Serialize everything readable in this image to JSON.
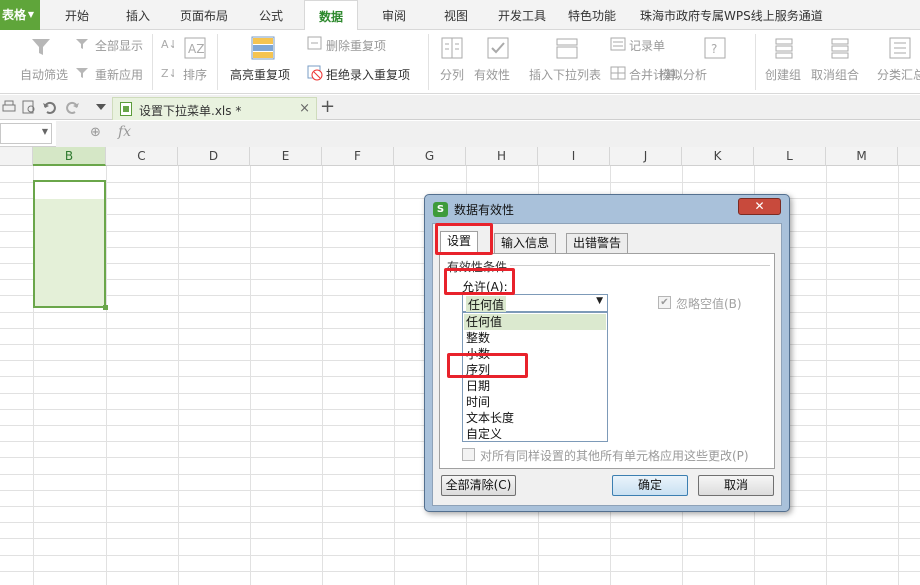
{
  "app": {
    "menu_button_label": "表格"
  },
  "tabs": [
    {
      "label": "开始"
    },
    {
      "label": "插入"
    },
    {
      "label": "页面布局"
    },
    {
      "label": "公式"
    },
    {
      "label": "数据"
    },
    {
      "label": "审阅"
    },
    {
      "label": "视图"
    },
    {
      "label": "开发工具"
    },
    {
      "label": "特色功能"
    },
    {
      "label": "珠海市政府专属WPS线上服务通道"
    }
  ],
  "ribbon": {
    "auto_filter": "自动筛选",
    "show_all": "全部显示",
    "reapply": "重新应用",
    "sort": "排序",
    "highlight_duplicates": "高亮重复项",
    "remove_duplicates": "删除重复项",
    "reject_duplicates": "拒绝录入重复项",
    "split_column": "分列",
    "validation": "有效性",
    "insert_dropdown": "插入下拉列表",
    "record_form": "记录单",
    "consolidate": "合并计算",
    "what_if": "模拟分析",
    "group": "创建组",
    "ungroup": "取消组合",
    "subtotal": "分类汇总"
  },
  "document": {
    "tab_name": "设置下拉菜单.xls *",
    "close_symbol": "×",
    "new_tab_symbol": "+"
  },
  "formula_bar": {
    "fx_label": "fx",
    "zoom_symbol": "⊕"
  },
  "sheet": {
    "columns": [
      "B",
      "C",
      "D",
      "E",
      "F",
      "G",
      "H",
      "I",
      "J",
      "K",
      "L",
      "M"
    ],
    "selected_column": "B"
  },
  "dialog": {
    "title": "数据有效性",
    "close_symbol": "✕",
    "tabs": [
      "设置",
      "输入信息",
      "出错警告"
    ],
    "active_tab": "设置",
    "group_label": "有效性条件",
    "allow_label": "允许(A):",
    "allow_value": "任何值",
    "ignore_blank": "忽略空值(B)",
    "ignore_blank_checked": true,
    "options": [
      "任何值",
      "整数",
      "小数",
      "序列",
      "日期",
      "时间",
      "文本长度",
      "自定义"
    ],
    "highlighted_option": "任何值",
    "apply_all_text": "对所有同样设置的其他所有单元格应用这些更改(P)",
    "clear_all_button": "全部清除(C)",
    "ok_button": "确定",
    "cancel_button": "取消"
  },
  "colors": {
    "accent_green": "#5fa53a",
    "annotation_red": "#e8222b"
  }
}
